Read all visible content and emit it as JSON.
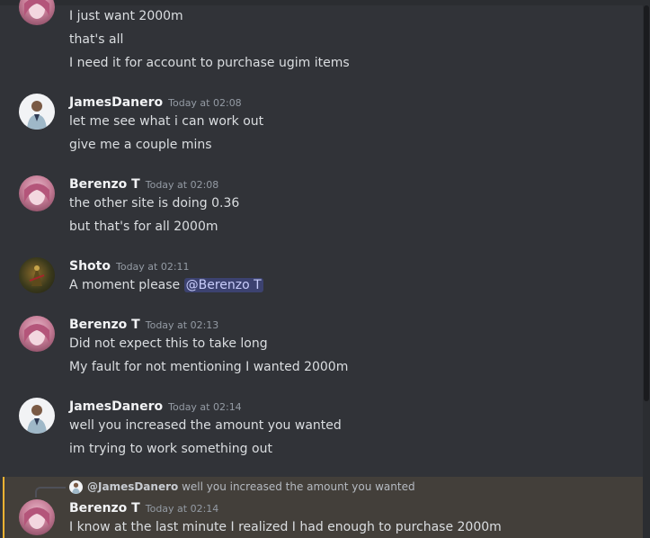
{
  "messages": [
    {
      "author": "",
      "timestamp": "",
      "lines": [
        "I just want 2000m",
        "that's all",
        "I need it for account to purchase ugim items"
      ]
    },
    {
      "author": "JamesDanero",
      "timestamp": "Today at 02:08",
      "lines": [
        "let me see what i can work out",
        "give me a couple mins"
      ]
    },
    {
      "author": "Berenzo T",
      "timestamp": "Today at 02:08",
      "lines": [
        "the other site is doing 0.36",
        "but that's for all 2000m"
      ]
    },
    {
      "author": "Shoto",
      "timestamp": "Today at 02:11",
      "lines": [
        "A moment please "
      ],
      "mention": "@Berenzo T"
    },
    {
      "author": "Berenzo T",
      "timestamp": "Today at 02:13",
      "lines": [
        "Did not expect this to take long",
        "My fault for not mentioning I wanted 2000m"
      ]
    },
    {
      "author": "JamesDanero",
      "timestamp": "Today at 02:14",
      "lines": [
        "well you increased the amount you wanted",
        "im trying to work something out"
      ]
    },
    {
      "author": "Berenzo T",
      "timestamp": "Today at 02:14",
      "reply": {
        "author": "@JamesDanero",
        "text": "well you increased the amount you wanted"
      },
      "lines": [
        "I know at the last minute I realized I had enough to purchase 2000m"
      ]
    }
  ],
  "colors": {
    "background": "#313338",
    "mention_bg": "#3c4270",
    "highlight_bg": "#433f3a",
    "highlight_bar": "#f0b232"
  }
}
